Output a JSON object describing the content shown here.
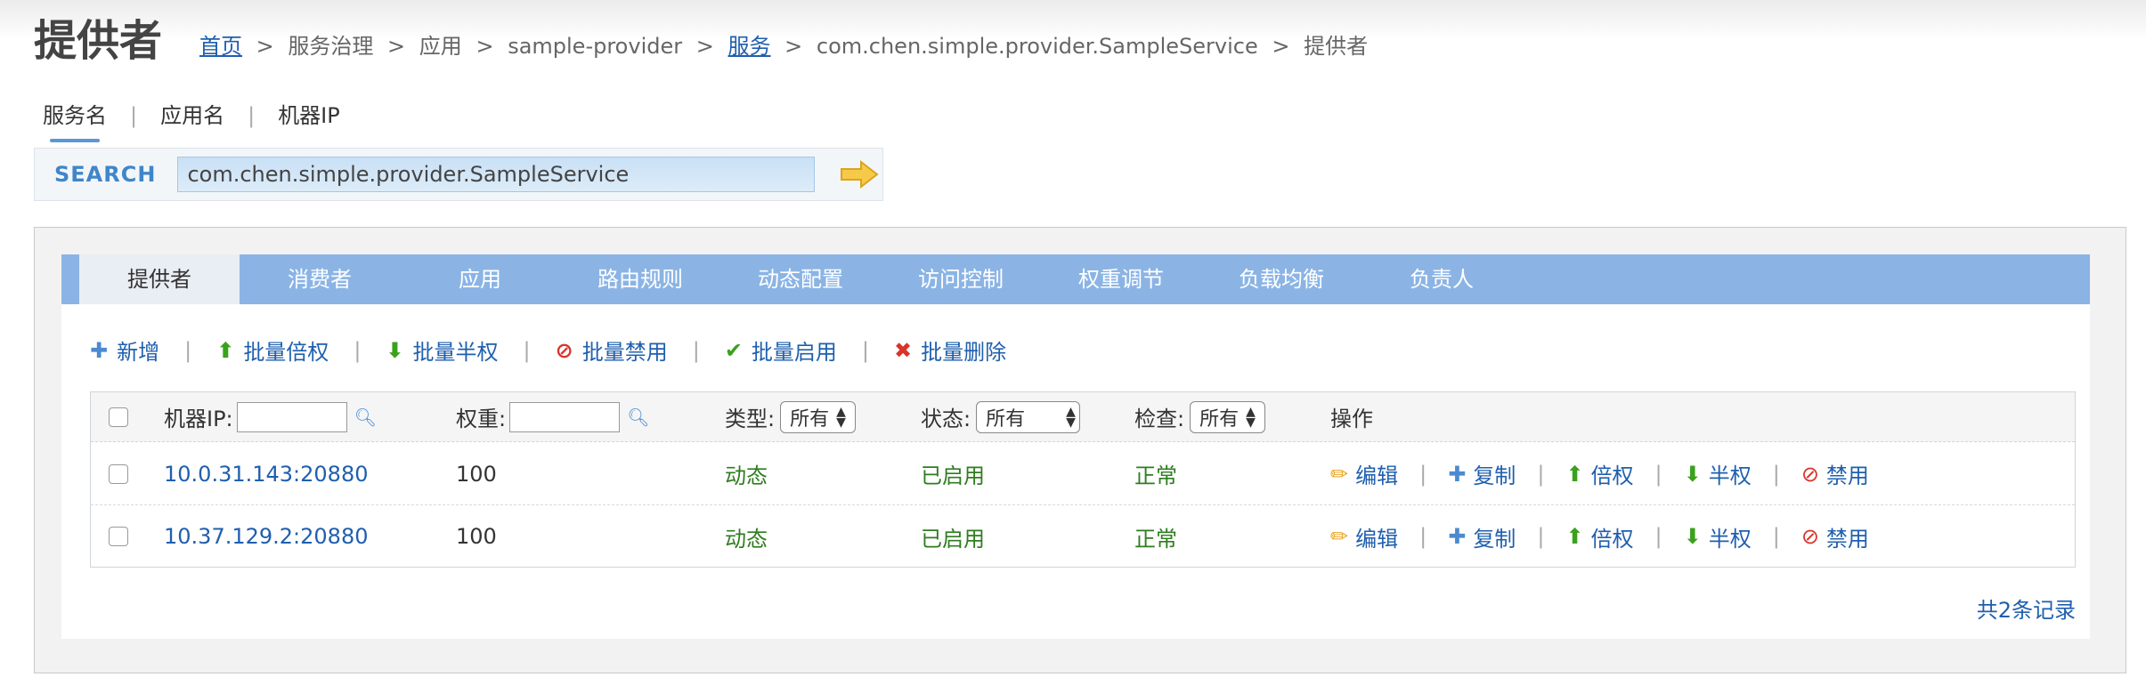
{
  "header": {
    "title": "提供者",
    "breadcrumb": {
      "home": "首页",
      "sep": ">",
      "governance": "服务治理",
      "app": "应用",
      "app_name": "sample-provider",
      "service": "服务",
      "service_name": "com.chen.simple.provider.SampleService",
      "current": "提供者"
    }
  },
  "search": {
    "tabs": [
      "服务名",
      "应用名",
      "机器IP"
    ],
    "label": "SEARCH",
    "value": "com.chen.simple.provider.SampleService"
  },
  "nav_tabs": [
    "提供者",
    "消费者",
    "应用",
    "路由规则",
    "动态配置",
    "访问控制",
    "权重调节",
    "负载均衡",
    "负责人"
  ],
  "actions": {
    "add": "新增",
    "batch_double": "批量倍权",
    "batch_half": "批量半权",
    "batch_disable": "批量禁用",
    "batch_enable": "批量启用",
    "batch_delete": "批量删除"
  },
  "table": {
    "headers": {
      "ip": "机器IP:",
      "weight": "权重:",
      "type": "类型:",
      "status": "状态:",
      "check": "检查:",
      "ops": "操作"
    },
    "select_all": "所有",
    "rows": [
      {
        "ip": "10.0.31.143:20880",
        "weight": "100",
        "type": "动态",
        "status": "已启用",
        "check": "正常"
      },
      {
        "ip": "10.37.129.2:20880",
        "weight": "100",
        "type": "动态",
        "status": "已启用",
        "check": "正常"
      }
    ],
    "ops": {
      "edit": "编辑",
      "copy": "复制",
      "double": "倍权",
      "half": "半权",
      "disable": "禁用"
    }
  },
  "total": "共2条记录",
  "colors": {
    "link": "#1f5fae",
    "nav_bar": "#8bb4e5",
    "green_text": "#2e7d1f",
    "search_label": "#3f86c9",
    "add_icon": "#4c8ad0",
    "up_icon": "#3aa11c",
    "delete_icon": "#d9342b"
  },
  "icons": {
    "go": "arrow-right-icon",
    "magnifier": "search-icon",
    "edit": "pencil-icon",
    "copy": "plus-icon",
    "double": "arrow-up-icon",
    "half": "arrow-down-icon",
    "disable": "forbidden-icon",
    "enable": "check-icon",
    "delete": "x-icon"
  }
}
